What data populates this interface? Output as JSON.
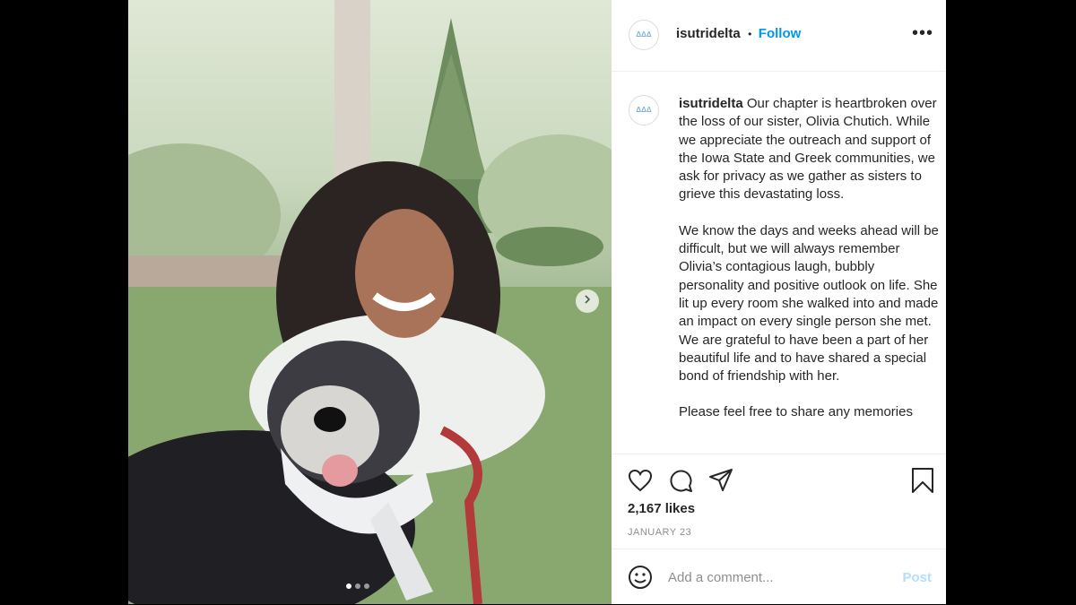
{
  "post": {
    "username": "isutridelta",
    "separator": "•",
    "follow_label": "Follow",
    "more_label": "•••",
    "avatar_logo": "ΔΔΔ",
    "photo_alt": "Smiling woman lying on grass with a dog",
    "caption_paragraphs": [
      "Our chapter is heartbroken over the loss of our sister, Olivia Chutich. While we appreciate the outreach and support of the Iowa State and Greek communities, we ask for privacy as we gather as sisters to grieve this devastating loss.",
      "We know the days and weeks ahead will be difficult, but we will always remember Olivia’s contagious laugh, bubbly personality and positive outlook on life. She lit up every room she walked into and made an impact on every single person she met. We are grateful to have been a part of her beautiful life and to have shared a special bond of friendship with her.",
      "Please feel free to share any memories"
    ],
    "likes": "2,167 likes",
    "date": "JANUARY 23",
    "comment_placeholder": "Add a comment...",
    "post_label": "Post",
    "carousel": {
      "count": 3,
      "active_index": 0
    }
  },
  "icons": {
    "like": "heart-icon",
    "comment": "comment-icon",
    "share": "share-icon",
    "save": "bookmark-icon",
    "emoji": "emoji-icon",
    "next": "chevron-right-icon"
  },
  "colors": {
    "link": "#0095f6",
    "post_disabled": "#b2dffc",
    "text": "#262626",
    "muted": "#8e8e8e"
  }
}
